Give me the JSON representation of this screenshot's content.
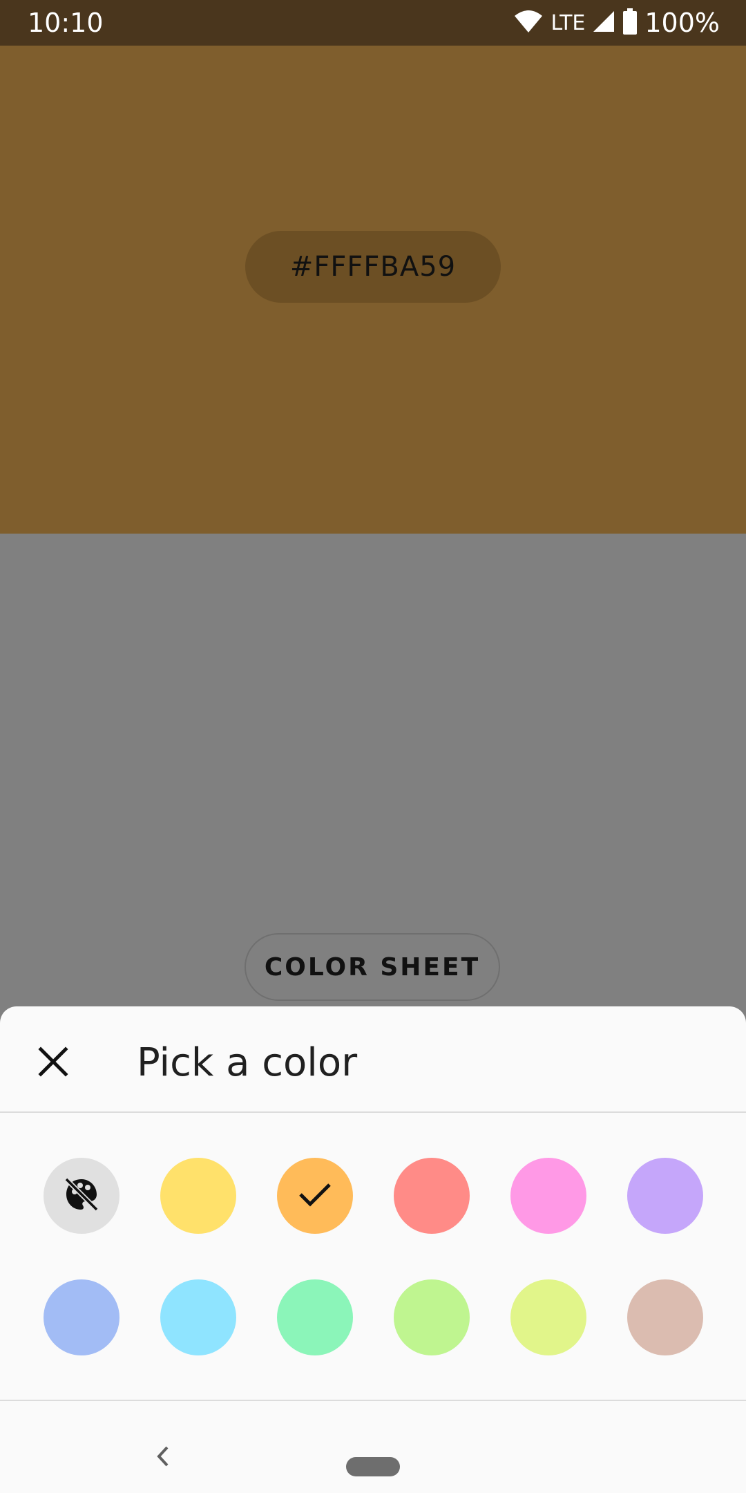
{
  "status_bar": {
    "time": "10:10",
    "network": "LTE",
    "battery": "100%",
    "icons": [
      "wifi-icon",
      "cell-signal-icon",
      "battery-icon"
    ]
  },
  "preview": {
    "hex_value": "#FFFFBA59",
    "background_color": "#7f5e2d"
  },
  "color_sheet_button": {
    "label": "COLOR SHEET"
  },
  "sheet": {
    "title": "Pick a color",
    "close_icon": "close-icon",
    "swatches": [
      {
        "name": "no-color",
        "color": "#e0e0e0",
        "icon": "palette-off-icon",
        "selected": false
      },
      {
        "name": "yellow",
        "color": "#ffe16b",
        "selected": false
      },
      {
        "name": "orange",
        "color": "#ffbb59",
        "selected": true,
        "icon": "check-icon"
      },
      {
        "name": "red",
        "color": "#ff8b87",
        "selected": false
      },
      {
        "name": "pink",
        "color": "#ff99e6",
        "selected": false
      },
      {
        "name": "purple",
        "color": "#c5a6fa",
        "selected": false
      },
      {
        "name": "blue",
        "color": "#a2bcf5",
        "selected": false
      },
      {
        "name": "light-blue",
        "color": "#8fe4ff",
        "selected": false
      },
      {
        "name": "green",
        "color": "#8bf5b9",
        "selected": false
      },
      {
        "name": "light-green",
        "color": "#bff590",
        "selected": false
      },
      {
        "name": "lime",
        "color": "#e1f58a",
        "selected": false
      },
      {
        "name": "beige",
        "color": "#dbbcb0",
        "selected": false
      }
    ]
  },
  "nav_bar": {
    "back_icon": "back-chevron-icon",
    "home_icon": "home-pill-icon"
  }
}
